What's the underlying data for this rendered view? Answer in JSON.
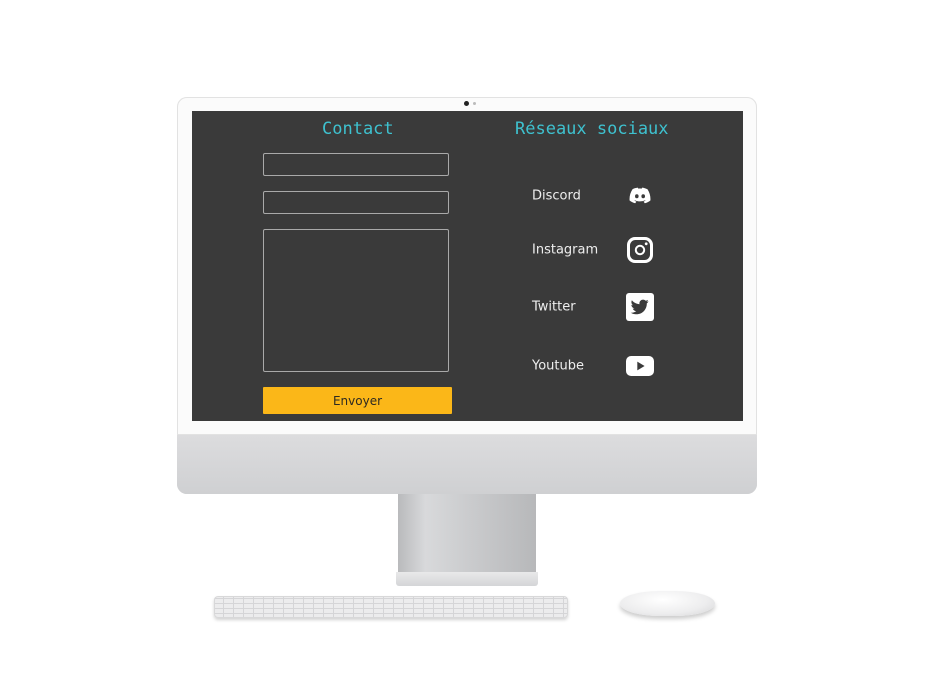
{
  "contact": {
    "title": "Contact",
    "send_label": "Envoyer"
  },
  "social": {
    "title": "Réseaux sociaux",
    "items": [
      {
        "label": "Discord",
        "icon": "discord-icon"
      },
      {
        "label": "Instagram",
        "icon": "instagram-icon"
      },
      {
        "label": "Twitter",
        "icon": "twitter-icon"
      },
      {
        "label": "Youtube",
        "icon": "youtube-icon"
      }
    ]
  },
  "colors": {
    "background": "#3a3a3a",
    "heading": "#3ec1cf",
    "button": "#fbb718",
    "text": "#eeeeee"
  }
}
